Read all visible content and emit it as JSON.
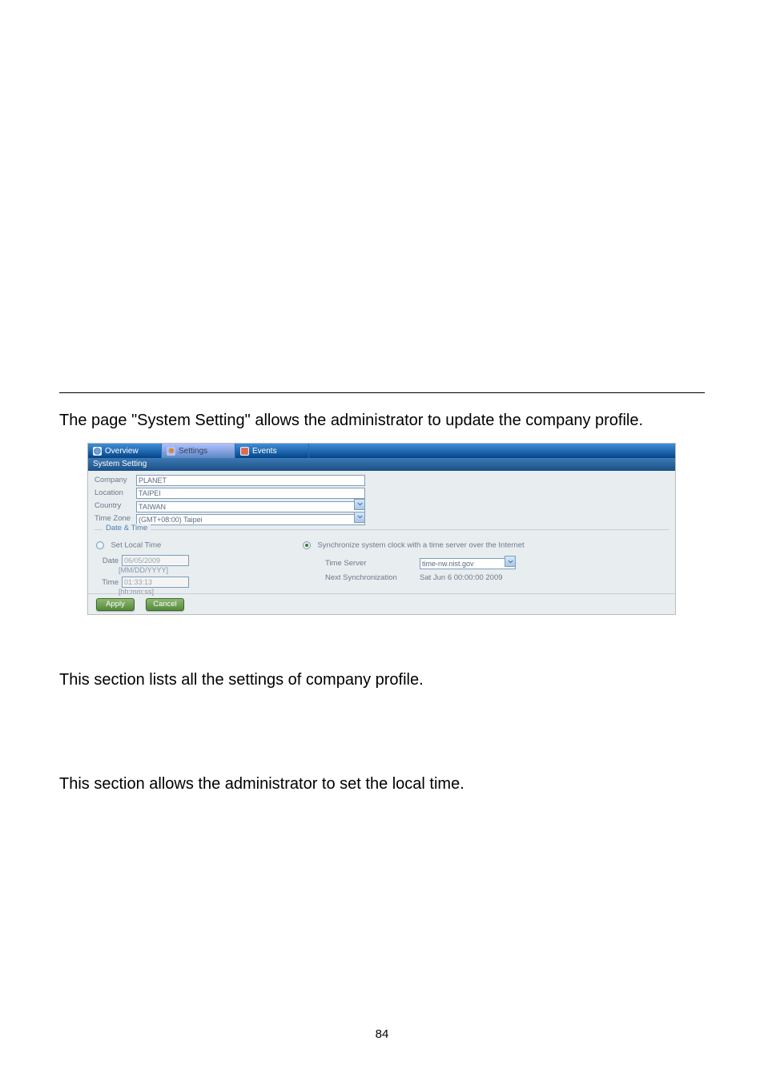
{
  "intro": "The page \"System Setting\" allows the administrator to update the company profile.",
  "tabs": {
    "overview": "Overview",
    "settings": "Settings",
    "events": "Events"
  },
  "subtab": "System Setting",
  "profile": {
    "company_label": "Company",
    "company_value": "PLANET",
    "location_label": "Location",
    "location_value": "TAIPEI",
    "country_label": "Country",
    "country_value": "TAIWAN",
    "timezone_label": "Time Zone",
    "timezone_value": "(GMT+08:00) Taipei"
  },
  "date_time": {
    "legend": "Date & Time",
    "set_local_label": "Set Local Time",
    "date_label": "Date",
    "date_value": "06/05/2009",
    "date_hint": "[MM/DD/YYYY]",
    "time_label": "Time",
    "time_value": "01:33:13",
    "time_hint": "[hh:mm:ss]",
    "sync_label": "Synchronize system clock with a time server over the Internet",
    "time_server_label": "Time Server",
    "time_server_value": "time-nw.nist.gov",
    "next_sync_label": "Next Synchronization",
    "next_sync_value": "Sat Jun 6 00:00:00 2009"
  },
  "buttons": {
    "apply": "Apply",
    "cancel": "Cancel"
  },
  "section1": "This section lists all the settings of company profile.",
  "section2": "This section allows the administrator to set the local time.",
  "page_number": "84"
}
